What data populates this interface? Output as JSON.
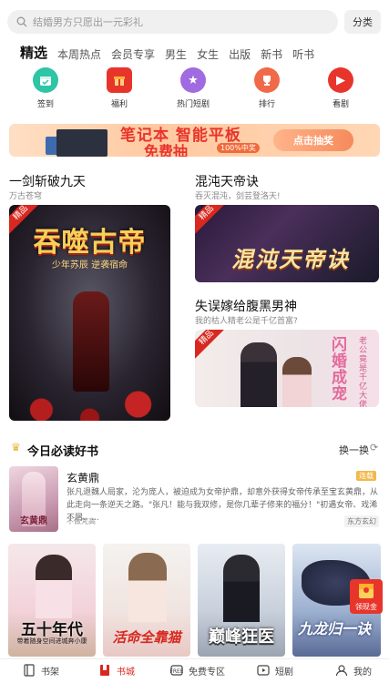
{
  "search": {
    "placeholder": "结婚男方只愿出一元彩礼",
    "category_label": "分类"
  },
  "tabs": [
    "精选",
    "本周热点",
    "会员专享",
    "男生",
    "女生",
    "出版",
    "新书",
    "听书"
  ],
  "quick": [
    {
      "label": "签到",
      "icon": "calendar-icon",
      "color": "#2ec4a6"
    },
    {
      "label": "福利",
      "icon": "gift-icon",
      "color": "#e8352b"
    },
    {
      "label": "热门短剧",
      "icon": "star-icon",
      "color": "#a06ae0"
    },
    {
      "label": "排行",
      "icon": "trophy-icon",
      "color": "#f06a4a"
    },
    {
      "label": "看剧",
      "icon": "play-icon",
      "color": "#e8352b"
    }
  ],
  "banner": {
    "line1": "笔记本 智能平板",
    "line2": "免费抽",
    "tag": "100%中奖",
    "cta": "点击抽奖"
  },
  "featured": [
    {
      "title": "一剑斩破九天",
      "subtitle": "万古苍穹",
      "badge": "精品",
      "cover_title": "吞噬古帝",
      "cover_sub": "少年苏辰 逆袭宿命"
    },
    {
      "title": "混沌天帝诀",
      "subtitle": "吞灭混沌，剑芸登洛天!",
      "badge": "精品",
      "cover_title": "混沌天帝诀"
    },
    {
      "title": "失误嫁给腹黑男神",
      "subtitle": "我的枯人精老公是千亿首富?",
      "badge": "精品",
      "cover_title": "闪婚成宠",
      "cover_sub": "老公竟是千亿大佬"
    }
  ],
  "daily": {
    "title": "今日必读好书",
    "refresh": "换一换",
    "book": {
      "title": "玄黄鼎",
      "tag": "连载",
      "desc": "张凡退魏人局家，沦为庞人，被迫成为女帝护鼎，却意外获得女帝传承至宝玄黄鼎，从此走向一条逆天之路。\"张凡！能与我双修，是你几辈子修来的福分！\"初遇女帝、戏浠不屑、...",
      "author": "不做梵高",
      "meta": "东方玄幻",
      "cover_text": "玄黄鼎"
    }
  },
  "bottom_books": [
    {
      "title": "五十年代",
      "sub": "带着随身空间进城奔小康"
    },
    {
      "title": "活命全靠猫"
    },
    {
      "title": "巅峰狂医"
    },
    {
      "title": "九龙归一诀"
    }
  ],
  "gift": {
    "label": "领现金"
  },
  "nav": [
    {
      "label": "书架",
      "icon": "book-icon"
    },
    {
      "label": "书城",
      "icon": "bookmark-icon",
      "active": true
    },
    {
      "label": "免费专区",
      "icon": "free-icon"
    },
    {
      "label": "短剧",
      "icon": "video-icon"
    },
    {
      "label": "我的",
      "icon": "user-icon"
    }
  ]
}
